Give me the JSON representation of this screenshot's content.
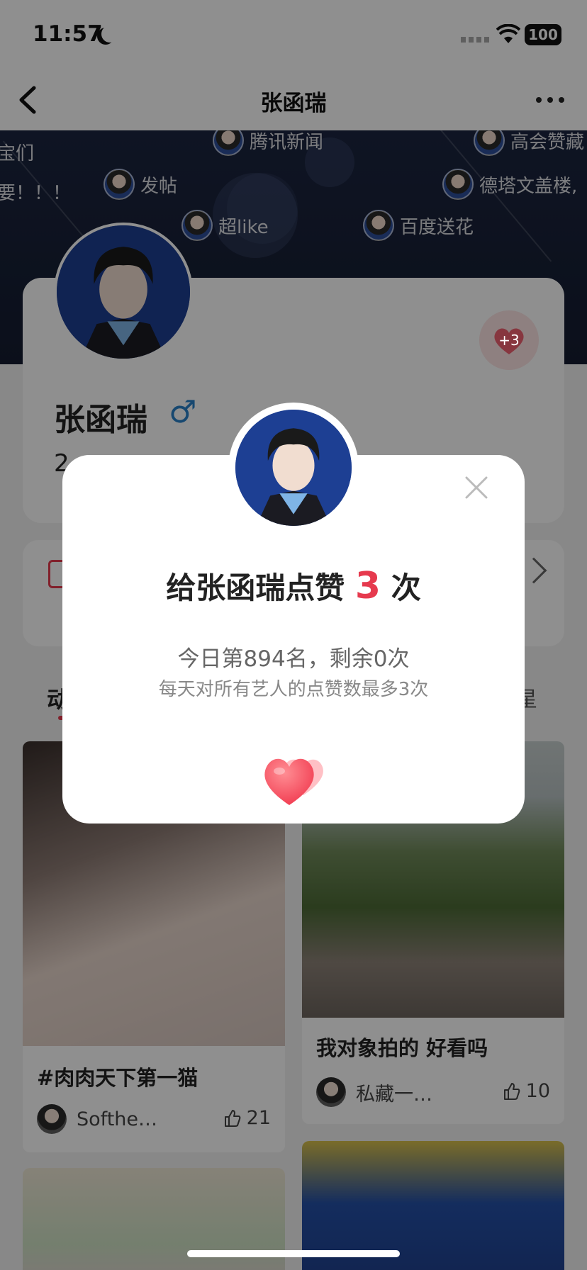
{
  "status_bar": {
    "time": "11:57",
    "battery": "100"
  },
  "nav": {
    "title": "张函瑞"
  },
  "banner": {
    "danmu": [
      {
        "text": "宝们"
      },
      {
        "text": "腾讯新闻"
      },
      {
        "text": "高会赞藏"
      },
      {
        "text": "要！！！"
      },
      {
        "text": "发帖"
      },
      {
        "text": "德塔文盖楼,"
      },
      {
        "text": "超like"
      },
      {
        "text": "百度送花"
      }
    ]
  },
  "profile": {
    "name": "张函瑞",
    "gender_symbol": "♂",
    "count_partial": "2",
    "heart_badge": "+3"
  },
  "tabs": {
    "left_partial": "动",
    "right_partial": "星"
  },
  "feed": [
    {
      "title": "#肉肉天下第一猫",
      "author": "Softhe…",
      "likes": "21"
    },
    {
      "title": "我对象拍的  好看吗",
      "author": "私藏一…",
      "likes": "10"
    }
  ],
  "modal": {
    "title_prefix": "给张函瑞点赞",
    "title_count": "3",
    "title_suffix": "次",
    "rank": "今日第894名，剩余0次",
    "rule": "每天对所有艺人的点赞数最多3次"
  },
  "colors": {
    "accent": "#e63a4e",
    "gender": "#2a80c8"
  }
}
